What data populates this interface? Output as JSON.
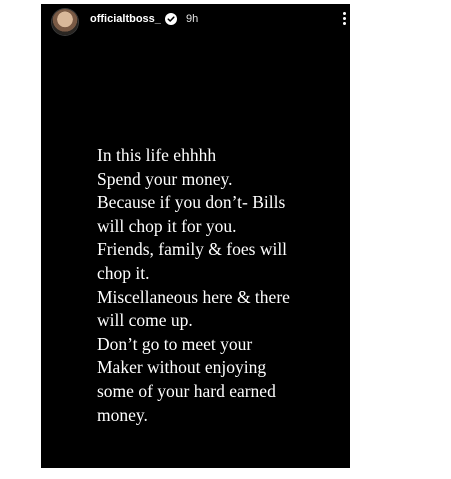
{
  "story": {
    "username": "officialtboss_",
    "time_ago": "9h",
    "avatar_icon": "profile-avatar",
    "verified_icon": "verified-badge-icon",
    "menu_icon": "more-vertical-icon",
    "lines": [
      "In this life ehhhh",
      "Spend your money.",
      "Because if you don’t- Bills",
      "will chop it for you.",
      "Friends, family & foes will",
      "chop it.",
      "Miscellaneous here & there",
      "will come up.",
      "Don’t go to meet your",
      "Maker without enjoying",
      "some of your hard earned",
      "money."
    ]
  },
  "colors": {
    "background": "#000000",
    "text": "#ffffff",
    "page": "#ffffff"
  }
}
